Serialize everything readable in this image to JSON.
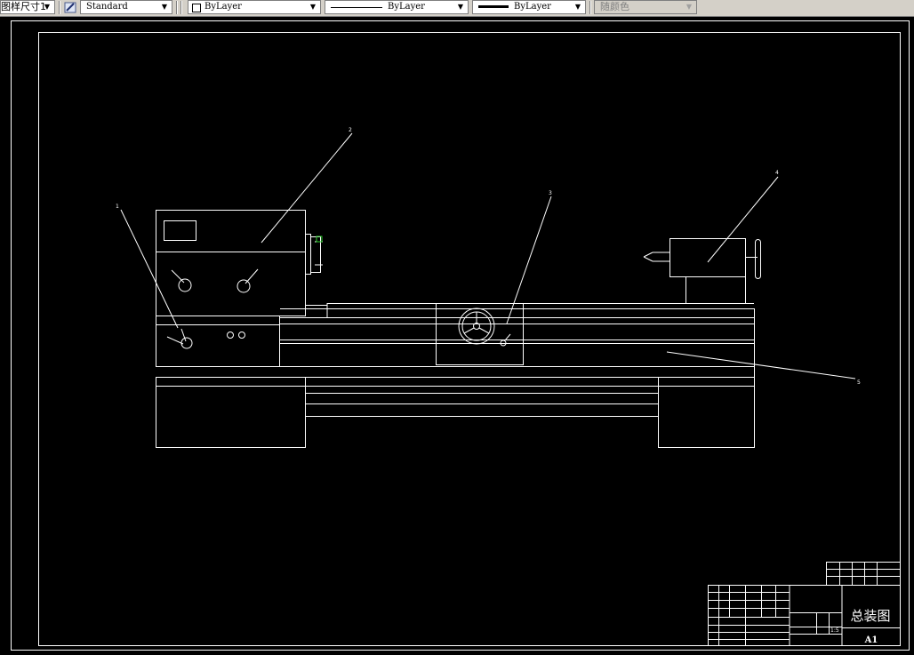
{
  "toolbar": {
    "dimstyle_value": "图样尺寸1",
    "textstyle_value": "Standard",
    "layer_value": "ByLayer",
    "linetype_value": "ByLayer",
    "lineweight_value": "ByLayer",
    "color_value": "随颜色"
  },
  "drawing": {
    "balloons": [
      "1",
      "2",
      "3",
      "4",
      "5"
    ],
    "title_block": {
      "title": "总装图",
      "sheet_size": "A1",
      "scale": "1:5"
    }
  }
}
